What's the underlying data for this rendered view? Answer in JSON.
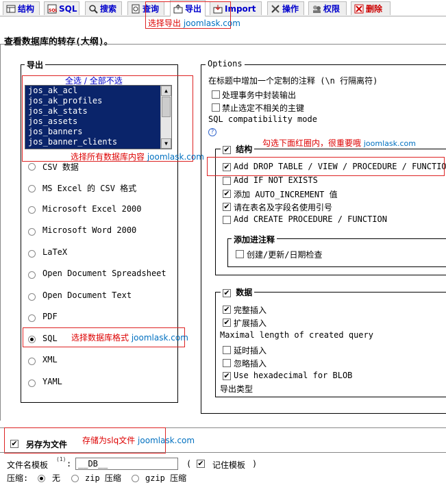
{
  "tabs": [
    {
      "label": "结构",
      "icon": "structure-icon",
      "x": 0
    },
    {
      "label": "SQL",
      "icon": "sql-icon"
    },
    {
      "label": "搜索",
      "icon": "search-icon"
    },
    {
      "label": "查询",
      "icon": "query-icon"
    },
    {
      "label": "导出",
      "icon": "export-icon"
    },
    {
      "label": "Import",
      "icon": "import-icon"
    },
    {
      "label": "操作",
      "icon": "operations-icon"
    },
    {
      "label": "权限",
      "icon": "privileges-icon"
    },
    {
      "label": "删除",
      "icon": "delete-icon"
    }
  ],
  "annotations": {
    "export_cn": "选择导出",
    "export_en": "joomlask.com",
    "all_db_cn": "选择所有数据库内容",
    "all_db_en": "joomlask.com",
    "format_cn": "选择数据库格式",
    "format_en": "joomlask.com",
    "check_cn": "勾选下面红圈内，很重要哦",
    "check_en": "joomlask.com",
    "save_cn": "存储为slq文件",
    "save_en": "joomlask.com"
  },
  "page_title": "查看数据库的转存(大纲)。",
  "export": {
    "legend": "导出",
    "select_all": "全选",
    "separator": "/",
    "select_none": "全部不选",
    "tables": [
      "jos_ak_acl",
      "jos_ak_profiles",
      "jos_ak_stats",
      "jos_assets",
      "jos_banners",
      "jos_banner_clients"
    ],
    "formats": [
      {
        "label": "CSV 数据",
        "selected": false
      },
      {
        "label": "MS Excel 的 CSV 格式",
        "selected": false
      },
      {
        "label": "Microsoft Excel 2000",
        "selected": false
      },
      {
        "label": "Microsoft Word 2000",
        "selected": false
      },
      {
        "label": "LaTeX",
        "selected": false
      },
      {
        "label": "Open Document Spreadsheet",
        "selected": false
      },
      {
        "label": "Open Document Text",
        "selected": false
      },
      {
        "label": "PDF",
        "selected": false
      },
      {
        "label": "SQL",
        "selected": true
      },
      {
        "label": "XML",
        "selected": false
      },
      {
        "label": "YAML",
        "selected": false
      }
    ]
  },
  "options": {
    "legend": "Options",
    "header_comment": "在标题中增加一个定制的注释 (\\n 行隔离符)",
    "transaction": "处理事务中封装输出",
    "disable_fk": "禁止选定不相关的主键",
    "compat_mode": "SQL compatibility mode",
    "help_icon": "?",
    "structure": {
      "legend": "结构",
      "items": [
        {
          "label": "Add DROP TABLE / VIEW / PROCEDURE / FUNCTION",
          "checked": true
        },
        {
          "label": "Add IF NOT EXISTS",
          "checked": false
        },
        {
          "label": "添加 AUTO_INCREMENT 值",
          "checked": true
        },
        {
          "label": "请在表名及字段名使用引号",
          "checked": true
        },
        {
          "label": "Add CREATE PROCEDURE / FUNCTION",
          "checked": false
        }
      ],
      "comments_legend": "添加进注释",
      "comments_item": "创建/更新/日期检查"
    },
    "data": {
      "legend": "数据",
      "complete_insert": "完整插入",
      "extended_insert": "扩展插入",
      "max_length": "Maximal length of created query",
      "delayed_insert": "延时插入",
      "ignore_insert": "忽略插入",
      "hex_blob": "Use hexadecimal for BLOB",
      "export_type": "导出类型"
    }
  },
  "save": {
    "legend": "另存为文件",
    "template_label": "文件名模板",
    "footnote": "(1)",
    "colon": ":",
    "template_value": "__DB__",
    "paren_open": "(",
    "remember": "记住模板",
    "paren_close": ")",
    "compress_label": "压缩:",
    "compress_none": "无",
    "compress_zip": "zip 压缩",
    "compress_gzip": "gzip 压缩"
  },
  "colors": {
    "tab_text": "#0000cc",
    "delete": "#cc0000",
    "annotation_red": "#dd0000",
    "annotation_blue": "#0070c0",
    "listbox_bg": "#0a246a"
  }
}
